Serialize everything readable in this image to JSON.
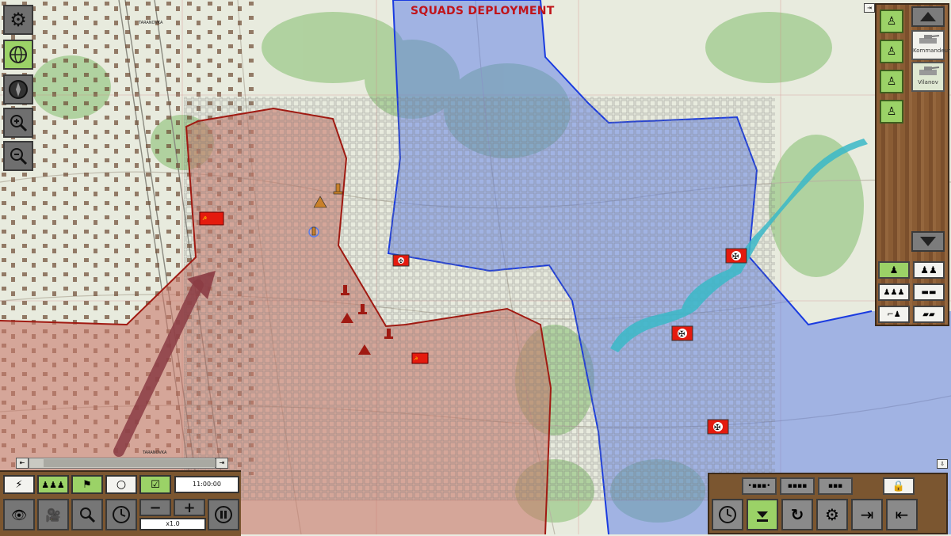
{
  "title": "SQUADS DEPLOYMENT",
  "time": "11:00:00",
  "speed": "x1.0",
  "colors": {
    "soviet_zone": "#c8786a",
    "german_zone": "#5a7be8",
    "zone_border_red": "#a01a12",
    "zone_border_blue": "#1a3be0",
    "accent_green": "#9bd267",
    "title_red": "#c0141a"
  },
  "map": {
    "place_labels": [
      "TARANOVKA",
      "TARANOVKA"
    ]
  },
  "left_toolbar": [
    {
      "name": "settings-button",
      "icon": "gear-icon"
    },
    {
      "name": "world-button",
      "icon": "globe-icon",
      "active": true
    },
    {
      "name": "compass-button",
      "icon": "compass-icon"
    },
    {
      "name": "zoom-in-button",
      "icon": "zoom-in-icon"
    },
    {
      "name": "zoom-out-button",
      "icon": "zoom-out-icon"
    }
  ],
  "unit_panel": {
    "cards": [
      {
        "label": "Kommandeur"
      },
      {
        "label": "Vilanov"
      }
    ],
    "filters": [
      "infantry",
      "armor",
      "squads",
      "tank",
      "artillery",
      "truck"
    ]
  },
  "bottom_left": {
    "top_buttons": [
      "lightning-icon",
      "squad-icon",
      "flag-icon",
      "circle-icon",
      "checkbox-icon"
    ],
    "bottom_buttons": [
      "binoculars-icon",
      "camera-icon",
      "magnifier-icon",
      "clock-icon",
      "minus-icon",
      "plus-icon",
      "pause-icon"
    ],
    "minus": "−",
    "plus": "+"
  },
  "bottom_right": {
    "formations": [
      "line-formation-icon",
      "column-formation-icon",
      "block-formation-icon"
    ],
    "buttons": [
      "clock-icon",
      "deploy-icon",
      "rotate-icon",
      "gear-half-icon",
      "enter-icon",
      "exit-icon"
    ]
  }
}
